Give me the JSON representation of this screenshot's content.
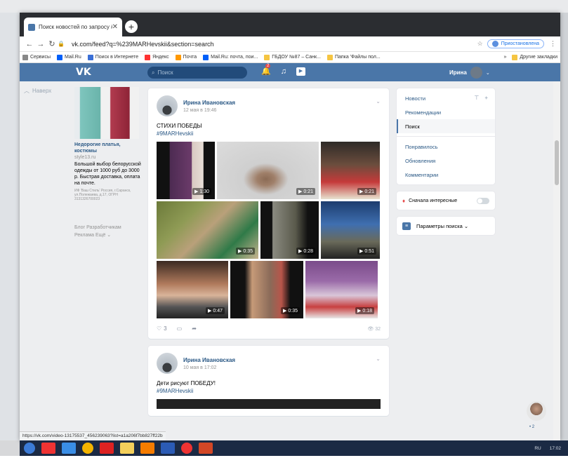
{
  "browser": {
    "tab_title": "Поиск новостей по запросу #9...",
    "tab_close": "✕",
    "new_tab": "+",
    "url": "vk.com/feed?q=%239MARHevskii&section=search",
    "profile_label": "Приостановлена",
    "bookmarks": [
      "Сервисы",
      "Mail.Ru",
      "Поиск в Интернете",
      "Яндекс",
      "Почта",
      "Mail.Ru: почта, пои...",
      "ГБДОУ №87 – Санк...",
      "Папка 'Файлы пол..."
    ],
    "bookmarks_more": "»",
    "bookmarks_other": "Другие закладки"
  },
  "vk": {
    "logo": "VK",
    "search_placeholder": "Поиск",
    "notif_count": "2",
    "user_name": "Ирина"
  },
  "left": {
    "back": "Наверх",
    "ad_title": "Недорогие платья, костюмы",
    "ad_domain": "style13.ru",
    "ad_text": "Большой выбор белорусской одежды от 1000 руб до 3000 р. Быстрая доставка, оплата на почте.",
    "ad_legal": "ИФ 'Ваш Стиль' Россия, г.Саранск, ул.Полежаева, д.17, ОГРН 3131326700023",
    "footer1": "Блог   Разработчикам",
    "footer2": "Реклама   Ещё ⌄"
  },
  "post1": {
    "author": "Ирина Ивановская",
    "date": "12 мая в 19:46",
    "text": "СТИХИ ПОБЕДЫ",
    "hashtag": "#9MARHevskii",
    "durations": [
      "1:30",
      "0:21",
      "0:21",
      "0:35",
      "0:28",
      "0:51",
      "0:47",
      "0:35",
      "0:18"
    ],
    "likes": "3",
    "views": "32"
  },
  "post2": {
    "author": "Ирина Ивановская",
    "date": "10 мая в 17:02",
    "text": "Дети рисуют ПОБЕДУ!",
    "hashtag": "#9MARHevskii"
  },
  "right": {
    "menu": [
      "Новости",
      "Рекомендации",
      "Поиск",
      "Понравилось",
      "Обновления",
      "Комментарии"
    ],
    "interesting": "Сначала интересные",
    "params": "Параметры поиска ⌄"
  },
  "status_url": "https://vk.com/video-13175537_456239063?list=a1a206f7bb827ff22b",
  "chat_count": "• 2",
  "tray": {
    "lang": "RU",
    "time": "17:02"
  },
  "colors": {
    "vk_blue": "#4a76a8",
    "link": "#2a5885"
  }
}
